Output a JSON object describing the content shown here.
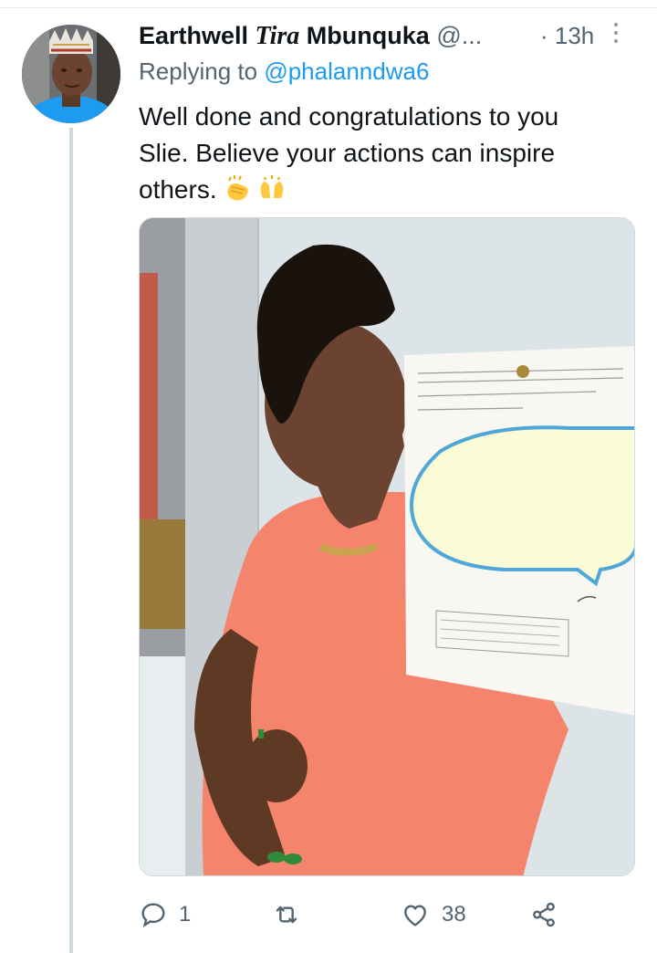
{
  "tweet": {
    "display_name_before": "Earthwell ",
    "display_name_italic": "Tira",
    "display_name_after": " Mbunquka",
    "handle_truncated": "@...",
    "time": "· 13h",
    "replying_prefix": "Replying to ",
    "replying_handle": "@phalanndwa6",
    "text": "Well done and congratulations to you Slie. Believe your actions can inspire others.",
    "emojis": [
      "clapping-hands",
      "raising-hands"
    ]
  },
  "actions": {
    "reply_count": "1",
    "retweet_count": "",
    "like_count": "38"
  },
  "colors": {
    "accent": "#1d9bf0",
    "secondary_text": "#536471",
    "dress": "#f4846c",
    "speech_bubble": "#fbfbd6",
    "bubble_outline": "#4fa7d8"
  }
}
